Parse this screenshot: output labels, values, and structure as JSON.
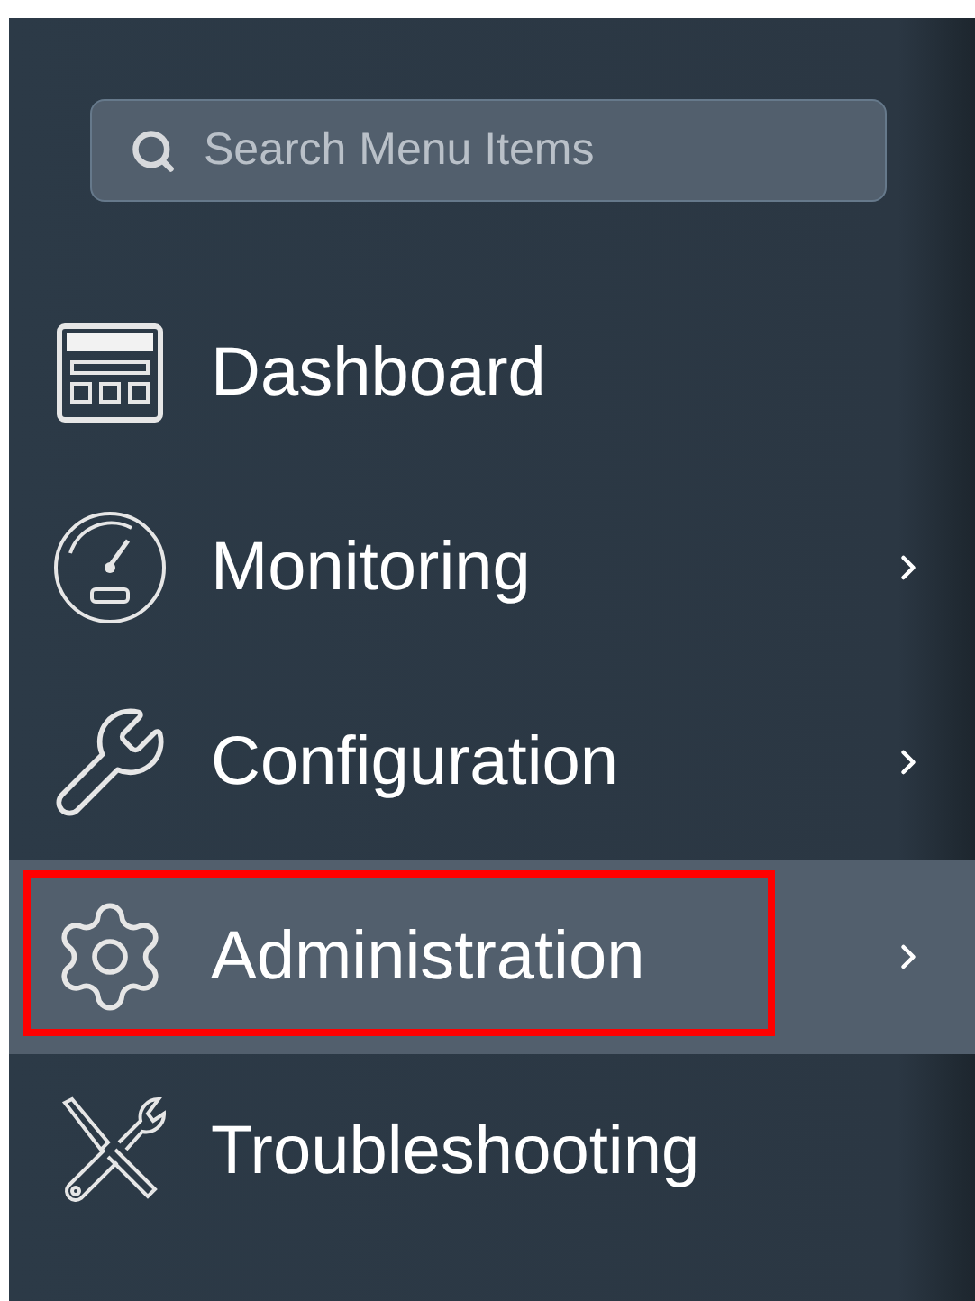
{
  "search": {
    "placeholder": "Search Menu Items"
  },
  "menu": [
    {
      "label": "Dashboard",
      "selected": false,
      "has_submenu": false,
      "marked": false
    },
    {
      "label": "Monitoring",
      "selected": false,
      "has_submenu": true,
      "marked": false
    },
    {
      "label": "Configuration",
      "selected": false,
      "has_submenu": true,
      "marked": false
    },
    {
      "label": "Administration",
      "selected": true,
      "has_submenu": true,
      "marked": true
    },
    {
      "label": "Troubleshooting",
      "selected": false,
      "has_submenu": false,
      "marked": false
    }
  ]
}
